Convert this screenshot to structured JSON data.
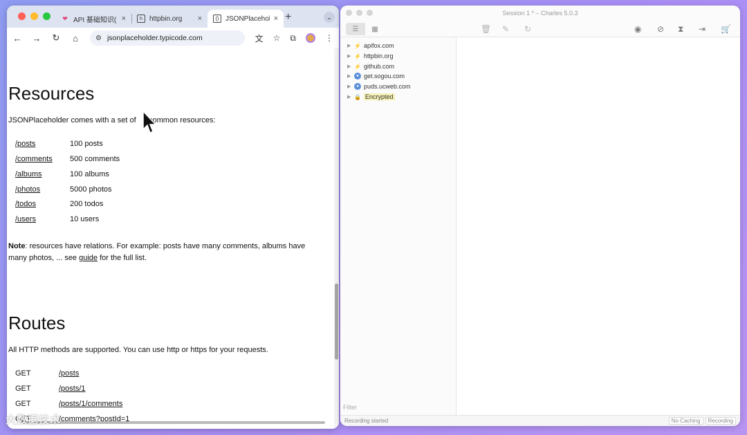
{
  "browser": {
    "tabs": [
      {
        "label": "API 基础知识(⁠",
        "icon": "apifox-icon"
      },
      {
        "label": "httpbin.org",
        "icon": "httpbin-icon"
      },
      {
        "label": "JSONPlacehold",
        "icon": "jsonplaceholder-icon",
        "active": true
      }
    ],
    "new_tab": "+",
    "address": "jsonplaceholder.typicode.com",
    "page": {
      "resources_heading": "Resources",
      "resources_intro_a": "JSONPlaceholder comes with a set of",
      "resources_intro_b": "common resources:",
      "resources": [
        {
          "path": "/posts",
          "desc": "100 posts"
        },
        {
          "path": "/comments",
          "desc": "500 comments"
        },
        {
          "path": "/albums",
          "desc": "100 albums"
        },
        {
          "path": "/photos",
          "desc": "5000 photos"
        },
        {
          "path": "/todos",
          "desc": "200 todos"
        },
        {
          "path": "/users",
          "desc": "10 users"
        }
      ],
      "note_label": "Note",
      "note_text_1": ": resources have relations. For example: posts have many comments, albums have",
      "note_text_2": "many photos, ... see",
      "note_link": "guide",
      "note_text_3": "for the full list.",
      "routes_heading": "Routes",
      "routes_intro": "All HTTP methods are supported. You can use http or https for your requests.",
      "routes": [
        {
          "method": "GET",
          "path": "/posts"
        },
        {
          "method": "GET",
          "path": "/posts/1"
        },
        {
          "method": "GET",
          "path": "/posts/1/comments"
        },
        {
          "method": "GET",
          "path": "/comments?postId=1"
        }
      ]
    }
  },
  "charles": {
    "title": "Session 1 * – Charles 5.0.3",
    "hosts": [
      {
        "name": "apifox.com",
        "icon": "bolt"
      },
      {
        "name": "httpbin.org",
        "icon": "bolt"
      },
      {
        "name": "github.com",
        "icon": "bolt"
      },
      {
        "name": "get.sogou.com",
        "icon": "globe"
      },
      {
        "name": "puds.ucweb.com",
        "icon": "globe"
      },
      {
        "name": "Encrypted",
        "icon": "lock"
      }
    ],
    "filter_label": "Filter",
    "status_left": "Recording started",
    "status_pills": [
      "No Caching",
      "Recording"
    ]
  },
  "watermark": "大数据技术"
}
